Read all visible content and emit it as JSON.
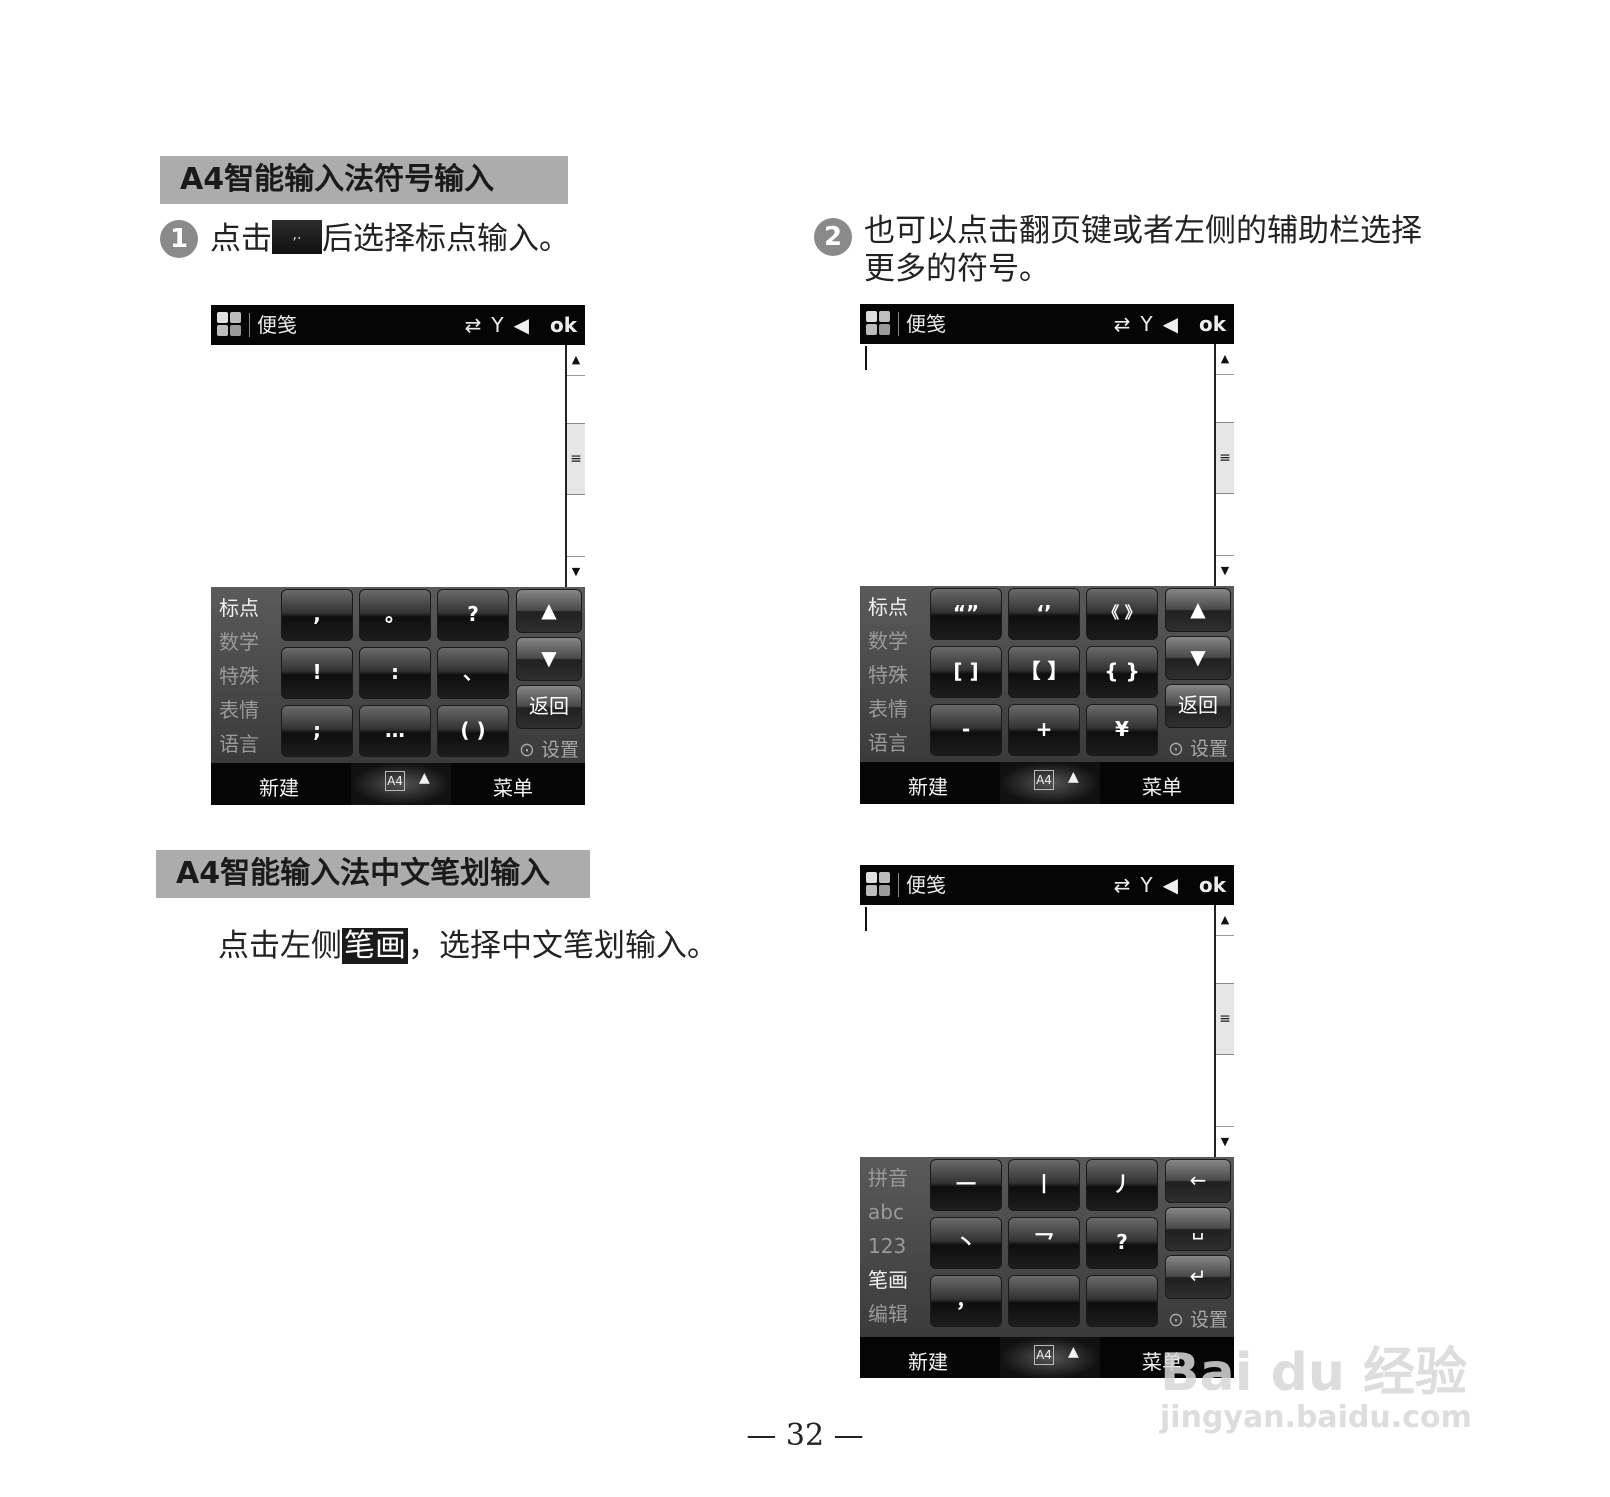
{
  "sections": {
    "symbol_title": "A4智能输入法符号输入",
    "stroke_title": "A4智能输入法中文笔划输入"
  },
  "step1": {
    "num": "1",
    "before": "点击",
    "after": "后选择标点输入。",
    "key_glyph": ",."
  },
  "step2": {
    "num": "2",
    "line1": "也可以点击翻页键或者左侧的辅助栏选择",
    "line2": "更多的符号。"
  },
  "stroke_text": {
    "before": "点击左侧",
    "highlight": "笔画",
    "after": "，选择中文笔划输入。"
  },
  "titlebar": {
    "title": "便笺",
    "ok": "ok",
    "sync_icon": "⇄",
    "signal_icon": "Y",
    "speaker_icon": "◀"
  },
  "bottombar": {
    "left": "新建",
    "right": "菜单",
    "ime": "A4",
    "caret": "▲"
  },
  "scroll": {
    "up": "▲",
    "down": "▼",
    "thumb": "≡"
  },
  "side_symbol": [
    "标点",
    "数学",
    "特殊",
    "表情",
    "语言"
  ],
  "side_stroke": [
    "拼音",
    "abc",
    "123",
    "笔画",
    "编辑"
  ],
  "settings": "⊙ 设置",
  "screen1_keys": [
    ",",
    "。",
    "?",
    "!",
    ":",
    "、",
    ";",
    "…",
    "( )"
  ],
  "screen2_keys": [
    "“”",
    "‘’",
    "《 》",
    "[ ]",
    "【 】",
    "{ }",
    "-",
    "+",
    "¥"
  ],
  "screen3_keys": [
    "一",
    "丨",
    "丿",
    "丶",
    "乛",
    "?",
    "，",
    "",
    ""
  ],
  "right_keys_symbol": {
    "up": "▲",
    "down": "▼",
    "back": "返回"
  },
  "right_keys_stroke": {
    "backspace": "←",
    "space": "␣",
    "enter": "↵"
  },
  "page_number": "— 32 —",
  "watermark": {
    "logo": "Bai du 经验",
    "url": "jingyan.baidu.com"
  }
}
